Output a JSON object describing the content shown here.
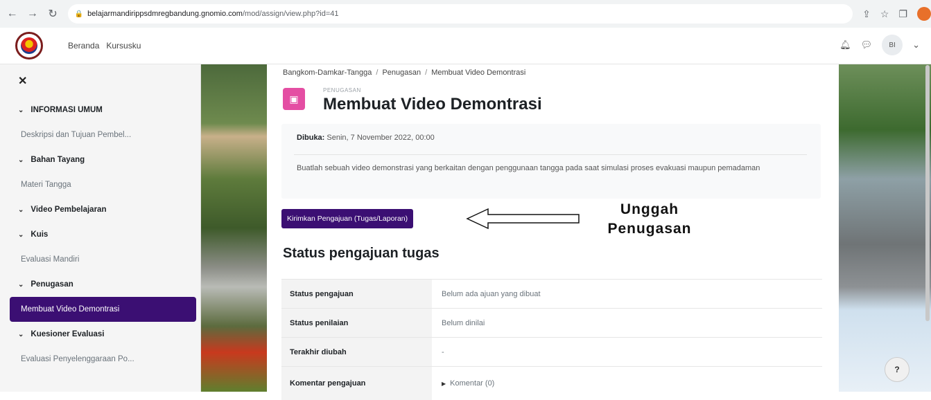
{
  "browser": {
    "url_host": "belajarmandirippsdmregbandung.gnomio.com",
    "url_path": "/mod/assign/view.php?id=41"
  },
  "navbar": {
    "links": [
      "Beranda",
      "Kursusku"
    ],
    "avatar_initials": "BI"
  },
  "drawer": {
    "items": [
      {
        "type": "section",
        "label": "INFORMASI UMUM"
      },
      {
        "type": "item",
        "label": "Deskripsi dan Tujuan Pembel..."
      },
      {
        "type": "section",
        "label": "Bahan Tayang"
      },
      {
        "type": "item",
        "label": "Materi Tangga"
      },
      {
        "type": "section",
        "label": "Video Pembelajaran"
      },
      {
        "type": "section",
        "label": "Kuis"
      },
      {
        "type": "item",
        "label": "Evaluasi Mandiri"
      },
      {
        "type": "section",
        "label": "Penugasan"
      },
      {
        "type": "item",
        "label": "Membuat Video Demontrasi",
        "active": true
      },
      {
        "type": "section",
        "label": "Kuesioner Evaluasi"
      },
      {
        "type": "item",
        "label": "Evaluasi Penyelenggaraan Po..."
      }
    ]
  },
  "breadcrumb": [
    "Bangkom-Damkar-Tangga",
    "Penugasan",
    "Membuat Video Demontrasi"
  ],
  "activity": {
    "type_label": "PENUGASAN",
    "title": "Membuat Video Demontrasi",
    "opened_label": "Dibuka:",
    "opened_value": "Senin, 7 November 2022, 00:00",
    "description": "Buatlah sebuah video demonstrasi yang berkaitan dengan penggunaan tangga pada saat simulasi proses evakuasi maupun pemadaman"
  },
  "submit_button": "Kirimkan Pengajuan (Tugas/Laporan)",
  "annotation": {
    "line1": "Unggah",
    "line2": "Penugasan"
  },
  "status": {
    "heading": "Status pengajuan tugas",
    "rows": [
      {
        "key": "Status pengajuan",
        "value": "Belum ada ajuan yang dibuat"
      },
      {
        "key": "Status penilaian",
        "value": "Belum dinilai"
      },
      {
        "key": "Terakhir diubah",
        "value": "-"
      },
      {
        "key": "Komentar pengajuan",
        "value": "Komentar (0)"
      }
    ]
  },
  "help_label": "?"
}
